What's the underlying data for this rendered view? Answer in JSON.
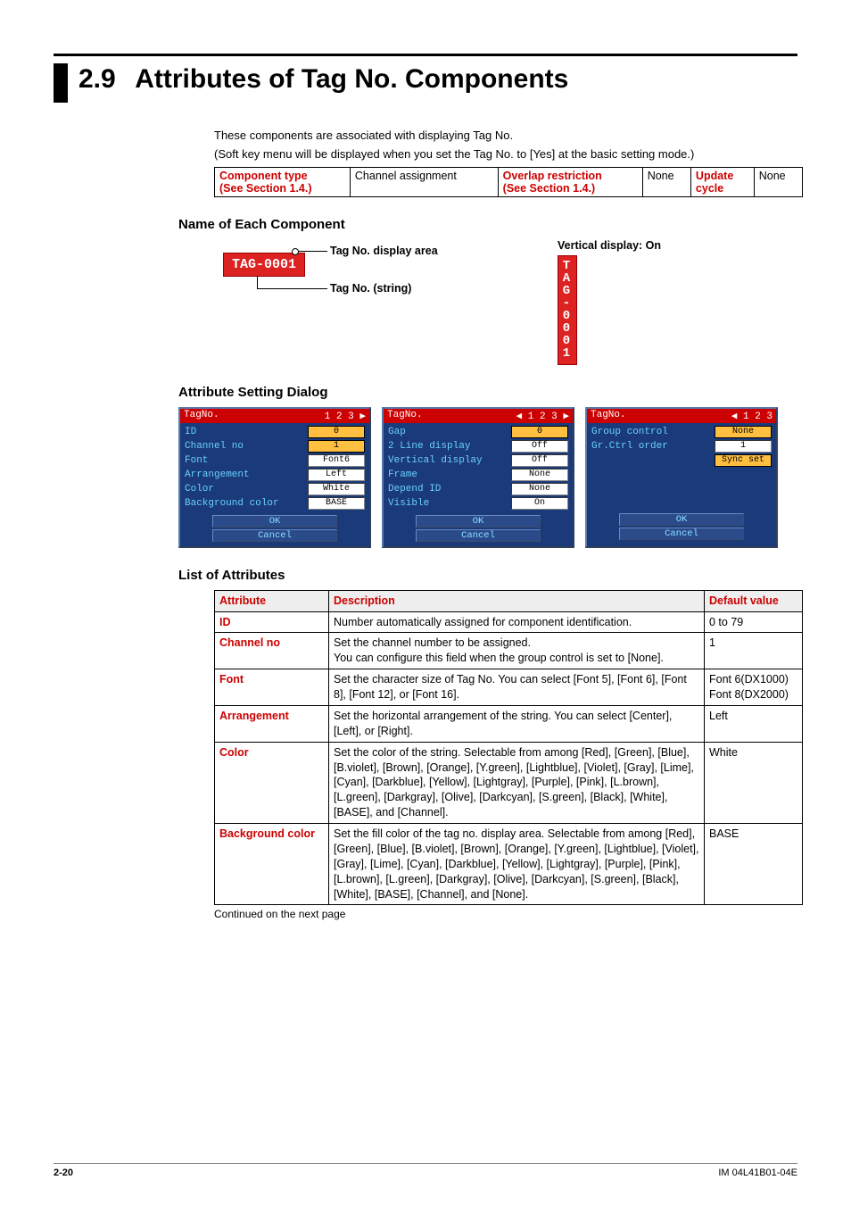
{
  "section": {
    "number": "2.9",
    "title": "Attributes of Tag No. Components"
  },
  "intro": {
    "line1": "These components are associated with displaying Tag No.",
    "line2": "(Soft key menu will be displayed when you set the Tag No. to [Yes] at the basic setting mode.)"
  },
  "comp_table": {
    "r1c1a": "Component type",
    "r1c2": "Channel assignment",
    "r1c3a": "Overlap restriction",
    "r1c4": "None",
    "r1c5a": "Update",
    "r1c6": "None",
    "r2c1a": "(See Section 1.4.)",
    "r2c3a": "(See Section 1.4.)",
    "r2c5a": "cycle"
  },
  "headings": {
    "name_comp": "Name of Each Component",
    "attr_dlg": "Attribute Setting Dialog",
    "list_attr": "List of Attributes"
  },
  "diagram": {
    "tag_text": "TAG-0001",
    "callout_area": "Tag No. display area",
    "callout_string": "Tag No. (string)",
    "vert_label": "Vertical display: On"
  },
  "dialog": {
    "title": "TagNo.",
    "tabs1": "1 2 3 ▶",
    "tabs2": "◀ 1 2 3 ▶",
    "tabs3": "◀ 1 2 3",
    "ok": "OK",
    "cancel": "Cancel",
    "sync": "Sync set",
    "p1": {
      "id": {
        "label": "ID",
        "value": "0"
      },
      "channel": {
        "label": "Channel no",
        "value": "1"
      },
      "font": {
        "label": "Font",
        "value": "Font6"
      },
      "arrangement": {
        "label": "Arrangement",
        "value": "Left"
      },
      "color": {
        "label": "Color",
        "value": "White"
      },
      "bgcolor": {
        "label": "Background color",
        "value": "BASE"
      }
    },
    "p2": {
      "gap": {
        "label": "Gap",
        "value": "0"
      },
      "twoline": {
        "label": "2 Line display",
        "value": "Off"
      },
      "vertical": {
        "label": "Vertical display",
        "value": "Off"
      },
      "frame": {
        "label": "Frame",
        "value": "None"
      },
      "depend": {
        "label": "Depend ID",
        "value": "None"
      },
      "visible": {
        "label": "Visible",
        "value": "On"
      }
    },
    "p3": {
      "groupctrl": {
        "label": "Group control",
        "value": "None"
      },
      "grorder": {
        "label": "Gr.Ctrl order",
        "value": "1"
      }
    }
  },
  "attr_table": {
    "head": {
      "attr": "Attribute",
      "desc": "Description",
      "def": "Default value"
    },
    "rows": [
      {
        "attr": "ID",
        "desc": "Number automatically assigned for component identification.",
        "def": "0 to 79"
      },
      {
        "attr": "Channel no",
        "desc": "Set the channel number to be assigned.\nYou can configure this field when the group control is set to [None].",
        "def": "1"
      },
      {
        "attr": "Font",
        "desc": "Set the character size of Tag No. You can select [Font 5], [Font 6], [Font 8], [Font 12], or [Font 16].",
        "def": "Font 6(DX1000)\nFont 8(DX2000)"
      },
      {
        "attr": "Arrangement",
        "desc": "Set the horizontal arrangement of the string. You can select [Center], [Left], or [Right].",
        "def": "Left"
      },
      {
        "attr": "Color",
        "desc": "Set the color of the string. Selectable from among [Red], [Green], [Blue], [B.violet], [Brown], [Orange], [Y.green], [Lightblue], [Violet], [Gray], [Lime], [Cyan], [Darkblue], [Yellow], [Lightgray], [Purple], [Pink], [L.brown], [L.green], [Darkgray], [Olive], [Darkcyan], [S.green], [Black], [White], [BASE], and [Channel].",
        "def": "White"
      },
      {
        "attr": "Background color",
        "desc": "Set the fill color of the tag no. display area. Selectable from among [Red], [Green], [Blue], [B.violet], [Brown], [Orange], [Y.green], [Lightblue], [Violet], [Gray], [Lime], [Cyan], [Darkblue], [Yellow], [Lightgray], [Purple], [Pink], [L.brown], [L.green], [Darkgray], [Olive], [Darkcyan], [S.green], [Black], [White], [BASE], [Channel], and [None].",
        "def": "BASE"
      }
    ],
    "continued": "Continued on the next page"
  },
  "footer": {
    "page": "2-20",
    "doc": "IM 04L41B01-04E"
  }
}
